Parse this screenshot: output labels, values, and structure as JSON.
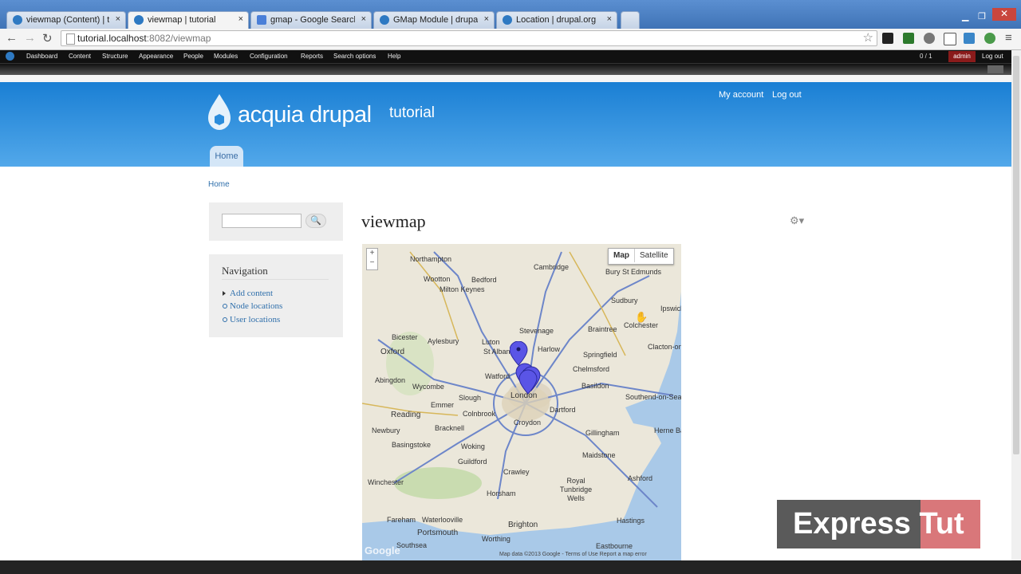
{
  "browser": {
    "tabs": [
      {
        "label": "viewmap (Content) | tutor",
        "active": false,
        "icon_color": "#2e79c2"
      },
      {
        "label": "viewmap | tutorial",
        "active": true,
        "icon_color": "#2e79c2"
      },
      {
        "label": "gmap - Google Search",
        "active": false,
        "icon_color": "#4a7fd8"
      },
      {
        "label": "GMap Module | drupal.org",
        "active": false,
        "icon_color": "#2e79c2"
      },
      {
        "label": "Location | drupal.org",
        "active": false,
        "icon_color": "#2e79c2"
      }
    ],
    "close_glyph": "×",
    "url_host": "tutorial.localhost",
    "url_rest": ":8082/viewmap"
  },
  "admin_menu": {
    "items": [
      "Dashboard",
      "Content",
      "Structure",
      "Appearance",
      "People",
      "Modules",
      "Configuration",
      "Reports",
      "Search options",
      "Help"
    ],
    "counter": "0 / 1",
    "user": "admin",
    "logout": "Log out"
  },
  "header": {
    "site_name": "acquia drupal",
    "slogan": "tutorial",
    "my_account": "My account",
    "log_out": "Log out",
    "home_tab": "Home",
    "brand_color": "#2b8ddc"
  },
  "page": {
    "breadcrumb": "Home",
    "title": "viewmap",
    "search_button": "🔍",
    "navigation": {
      "title": "Navigation",
      "items": [
        "Add content",
        "Node locations",
        "User locations"
      ]
    }
  },
  "map": {
    "type_map": "Map",
    "type_satellite": "Satellite",
    "zoom_in": "+",
    "zoom_out": "−",
    "copyright": "Map data ©2013 Google - Terms of Use   Report a map error",
    "google_logo": "Google",
    "labels": [
      "Northampton",
      "Cambridge",
      "Bury St Edmunds",
      "Bedford",
      "Milton Keynes",
      "Wootton",
      "Sudbury",
      "Stevenage",
      "Colchester",
      "Braintree",
      "Ipswich",
      "Luton",
      "Bicester",
      "Aylesbury",
      "Harlow",
      "Oxford",
      "St Albans",
      "Springfield",
      "Chelmsford",
      "Clacton-on-Sea",
      "Abingdon",
      "Wycombe",
      "Watford",
      "Basildon",
      "Slough",
      "London",
      "Southend-on-Sea",
      "Reading",
      "Emmer",
      "Colnbrook",
      "Dartford",
      "Newbury",
      "Bracknell",
      "Croydon",
      "Basingstoke",
      "Woking",
      "Gillingham",
      "Herne Bay",
      "Guildford",
      "Maidstone",
      "Crawley",
      "Ashford",
      "Winchester",
      "Royal Tunbridge Wells",
      "Horsham",
      "Hastings",
      "Portsmouth",
      "Brighton",
      "Worthing",
      "Southsea",
      "Fareham",
      "Waterlooville",
      "Eastbourne"
    ],
    "markers": 4
  },
  "watermark": {
    "text1": "Express",
    "text2": "Tut"
  }
}
